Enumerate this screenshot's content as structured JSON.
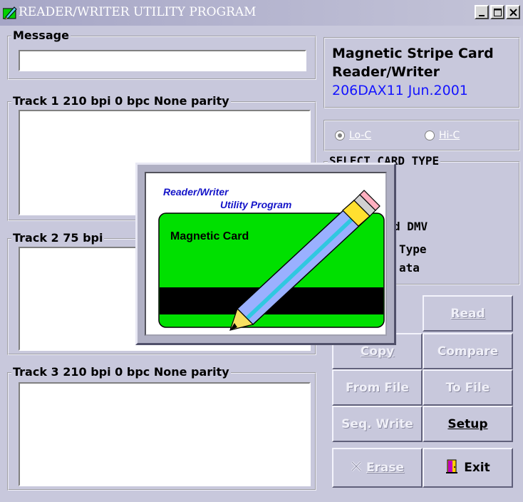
{
  "window": {
    "title": "READER/WRITER UTILITY PROGRAM",
    "controls": [
      "minimize",
      "maximize",
      "close"
    ]
  },
  "message": {
    "label": "Message",
    "value": ""
  },
  "track1": {
    "label": "Track 1  210 bpi  0 bpc  None parity",
    "value": ""
  },
  "track2": {
    "label": "Track 2  75 bpi",
    "value": ""
  },
  "track3": {
    "label": "Track 3  210 bpi  0 bpc  None parity",
    "value": ""
  },
  "device": {
    "line1": "Magnetic Stripe Card",
    "line2": "Reader/Writer",
    "line3": "206DAX11 Jun.2001",
    "line3_color": "#1414ff"
  },
  "coercivity": {
    "options": [
      {
        "label": "Lo-C",
        "selected": true
      },
      {
        "label": "Hi-C",
        "selected": false
      }
    ]
  },
  "card_type": {
    "label": "SELECT CARD TYPE",
    "visible_fragments": [
      "d DMV",
      "Type",
      "ata"
    ]
  },
  "buttons": {
    "read": "Read",
    "copy": "Copy",
    "compare": "Compare",
    "from_file": "From File",
    "to_file": "To File",
    "seq_write": "Seq. Write",
    "setup": "Setup",
    "erase": "Erase",
    "exit": "Exit"
  },
  "splash": {
    "line1": "Reader/Writer",
    "line2": "Utility Program",
    "card_label": "Magnetic Card",
    "card_color": "#00e000",
    "icon": "pencil-icon"
  },
  "colors": {
    "background": "#c8c8dc",
    "accent_blue": "#1414ff"
  }
}
